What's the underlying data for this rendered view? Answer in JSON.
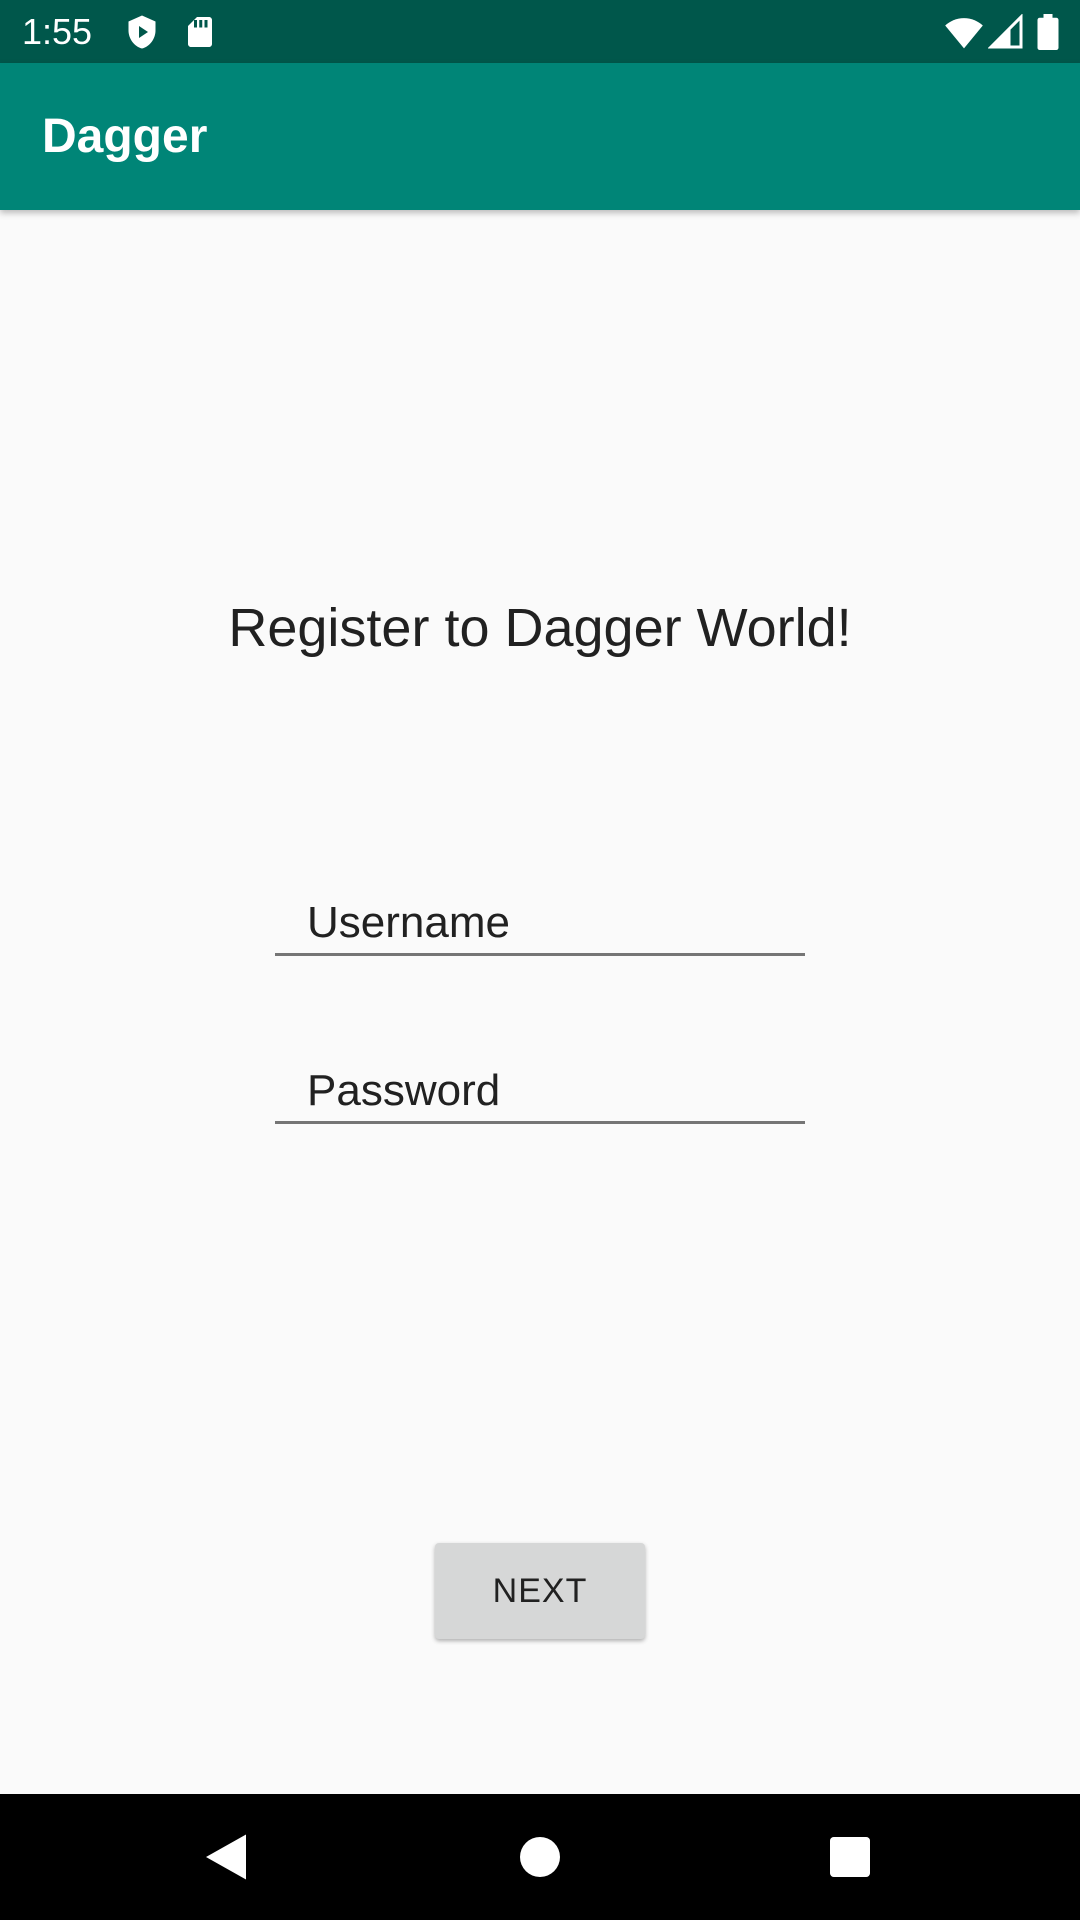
{
  "status_bar": {
    "time": "1:55",
    "icons": [
      "play-protect-icon",
      "sd-card-icon",
      "wifi-icon",
      "cell-signal-icon",
      "battery-icon"
    ],
    "background": "#00574b"
  },
  "app_bar": {
    "title": "Dagger",
    "background": "#008577"
  },
  "main": {
    "headline": "Register to Dagger World!",
    "username": {
      "value": "",
      "placeholder": "Username"
    },
    "password": {
      "value": "",
      "placeholder": "Password"
    },
    "next_label": "NEXT"
  },
  "nav_bar": {
    "buttons": [
      "back-icon",
      "home-icon",
      "recents-icon"
    ]
  }
}
